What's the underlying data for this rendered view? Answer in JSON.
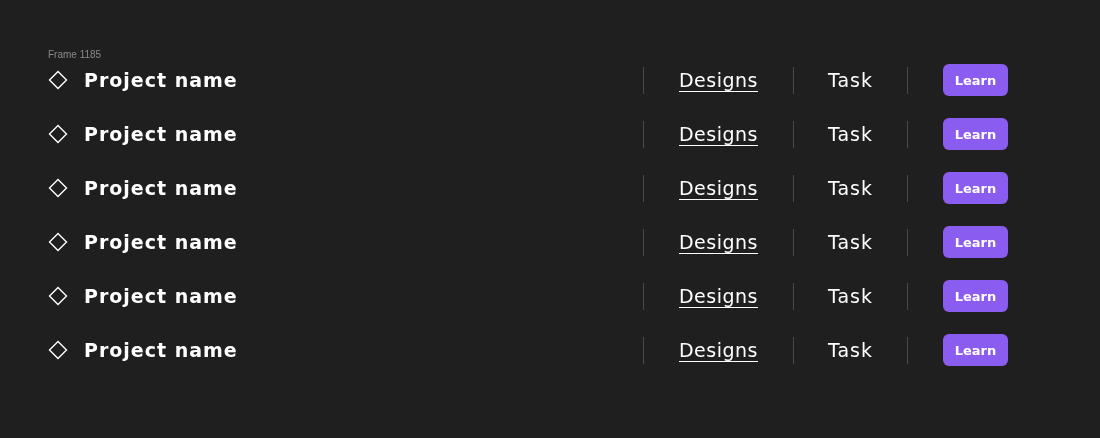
{
  "frame_label": "Frame 1185",
  "rows": [
    {
      "name": "Project name",
      "link": "Designs",
      "task": "Task",
      "button": "Learn"
    },
    {
      "name": "Project name",
      "link": "Designs",
      "task": "Task",
      "button": "Learn"
    },
    {
      "name": "Project name",
      "link": "Designs",
      "task": "Task",
      "button": "Learn"
    },
    {
      "name": "Project name",
      "link": "Designs",
      "task": "Task",
      "button": "Learn"
    },
    {
      "name": "Project name",
      "link": "Designs",
      "task": "Task",
      "button": "Learn"
    },
    {
      "name": "Project name",
      "link": "Designs",
      "task": "Task",
      "button": "Learn"
    }
  ]
}
